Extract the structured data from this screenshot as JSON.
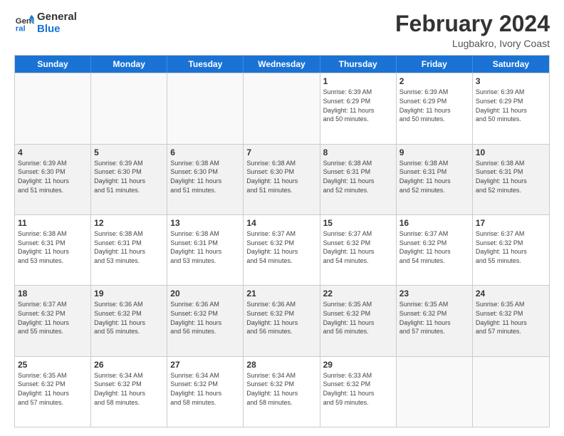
{
  "logo": {
    "line1": "General",
    "line2": "Blue"
  },
  "title": {
    "month": "February 2024",
    "location": "Lugbakro, Ivory Coast"
  },
  "header": {
    "days": [
      "Sunday",
      "Monday",
      "Tuesday",
      "Wednesday",
      "Thursday",
      "Friday",
      "Saturday"
    ]
  },
  "weeks": [
    [
      {
        "day": "",
        "info": "",
        "empty": true
      },
      {
        "day": "",
        "info": "",
        "empty": true
      },
      {
        "day": "",
        "info": "",
        "empty": true
      },
      {
        "day": "",
        "info": "",
        "empty": true
      },
      {
        "day": "1",
        "info": "Sunrise: 6:39 AM\nSunset: 6:29 PM\nDaylight: 11 hours\nand 50 minutes.",
        "empty": false
      },
      {
        "day": "2",
        "info": "Sunrise: 6:39 AM\nSunset: 6:29 PM\nDaylight: 11 hours\nand 50 minutes.",
        "empty": false
      },
      {
        "day": "3",
        "info": "Sunrise: 6:39 AM\nSunset: 6:29 PM\nDaylight: 11 hours\nand 50 minutes.",
        "empty": false
      }
    ],
    [
      {
        "day": "4",
        "info": "Sunrise: 6:39 AM\nSunset: 6:30 PM\nDaylight: 11 hours\nand 51 minutes.",
        "empty": false,
        "shaded": true
      },
      {
        "day": "5",
        "info": "Sunrise: 6:39 AM\nSunset: 6:30 PM\nDaylight: 11 hours\nand 51 minutes.",
        "empty": false,
        "shaded": true
      },
      {
        "day": "6",
        "info": "Sunrise: 6:38 AM\nSunset: 6:30 PM\nDaylight: 11 hours\nand 51 minutes.",
        "empty": false,
        "shaded": true
      },
      {
        "day": "7",
        "info": "Sunrise: 6:38 AM\nSunset: 6:30 PM\nDaylight: 11 hours\nand 51 minutes.",
        "empty": false,
        "shaded": true
      },
      {
        "day": "8",
        "info": "Sunrise: 6:38 AM\nSunset: 6:31 PM\nDaylight: 11 hours\nand 52 minutes.",
        "empty": false,
        "shaded": true
      },
      {
        "day": "9",
        "info": "Sunrise: 6:38 AM\nSunset: 6:31 PM\nDaylight: 11 hours\nand 52 minutes.",
        "empty": false,
        "shaded": true
      },
      {
        "day": "10",
        "info": "Sunrise: 6:38 AM\nSunset: 6:31 PM\nDaylight: 11 hours\nand 52 minutes.",
        "empty": false,
        "shaded": true
      }
    ],
    [
      {
        "day": "11",
        "info": "Sunrise: 6:38 AM\nSunset: 6:31 PM\nDaylight: 11 hours\nand 53 minutes.",
        "empty": false
      },
      {
        "day": "12",
        "info": "Sunrise: 6:38 AM\nSunset: 6:31 PM\nDaylight: 11 hours\nand 53 minutes.",
        "empty": false
      },
      {
        "day": "13",
        "info": "Sunrise: 6:38 AM\nSunset: 6:31 PM\nDaylight: 11 hours\nand 53 minutes.",
        "empty": false
      },
      {
        "day": "14",
        "info": "Sunrise: 6:37 AM\nSunset: 6:32 PM\nDaylight: 11 hours\nand 54 minutes.",
        "empty": false
      },
      {
        "day": "15",
        "info": "Sunrise: 6:37 AM\nSunset: 6:32 PM\nDaylight: 11 hours\nand 54 minutes.",
        "empty": false
      },
      {
        "day": "16",
        "info": "Sunrise: 6:37 AM\nSunset: 6:32 PM\nDaylight: 11 hours\nand 54 minutes.",
        "empty": false
      },
      {
        "day": "17",
        "info": "Sunrise: 6:37 AM\nSunset: 6:32 PM\nDaylight: 11 hours\nand 55 minutes.",
        "empty": false
      }
    ],
    [
      {
        "day": "18",
        "info": "Sunrise: 6:37 AM\nSunset: 6:32 PM\nDaylight: 11 hours\nand 55 minutes.",
        "empty": false,
        "shaded": true
      },
      {
        "day": "19",
        "info": "Sunrise: 6:36 AM\nSunset: 6:32 PM\nDaylight: 11 hours\nand 55 minutes.",
        "empty": false,
        "shaded": true
      },
      {
        "day": "20",
        "info": "Sunrise: 6:36 AM\nSunset: 6:32 PM\nDaylight: 11 hours\nand 56 minutes.",
        "empty": false,
        "shaded": true
      },
      {
        "day": "21",
        "info": "Sunrise: 6:36 AM\nSunset: 6:32 PM\nDaylight: 11 hours\nand 56 minutes.",
        "empty": false,
        "shaded": true
      },
      {
        "day": "22",
        "info": "Sunrise: 6:35 AM\nSunset: 6:32 PM\nDaylight: 11 hours\nand 56 minutes.",
        "empty": false,
        "shaded": true
      },
      {
        "day": "23",
        "info": "Sunrise: 6:35 AM\nSunset: 6:32 PM\nDaylight: 11 hours\nand 57 minutes.",
        "empty": false,
        "shaded": true
      },
      {
        "day": "24",
        "info": "Sunrise: 6:35 AM\nSunset: 6:32 PM\nDaylight: 11 hours\nand 57 minutes.",
        "empty": false,
        "shaded": true
      }
    ],
    [
      {
        "day": "25",
        "info": "Sunrise: 6:35 AM\nSunset: 6:32 PM\nDaylight: 11 hours\nand 57 minutes.",
        "empty": false
      },
      {
        "day": "26",
        "info": "Sunrise: 6:34 AM\nSunset: 6:32 PM\nDaylight: 11 hours\nand 58 minutes.",
        "empty": false
      },
      {
        "day": "27",
        "info": "Sunrise: 6:34 AM\nSunset: 6:32 PM\nDaylight: 11 hours\nand 58 minutes.",
        "empty": false
      },
      {
        "day": "28",
        "info": "Sunrise: 6:34 AM\nSunset: 6:32 PM\nDaylight: 11 hours\nand 58 minutes.",
        "empty": false
      },
      {
        "day": "29",
        "info": "Sunrise: 6:33 AM\nSunset: 6:32 PM\nDaylight: 11 hours\nand 59 minutes.",
        "empty": false
      },
      {
        "day": "",
        "info": "",
        "empty": true
      },
      {
        "day": "",
        "info": "",
        "empty": true
      }
    ]
  ]
}
